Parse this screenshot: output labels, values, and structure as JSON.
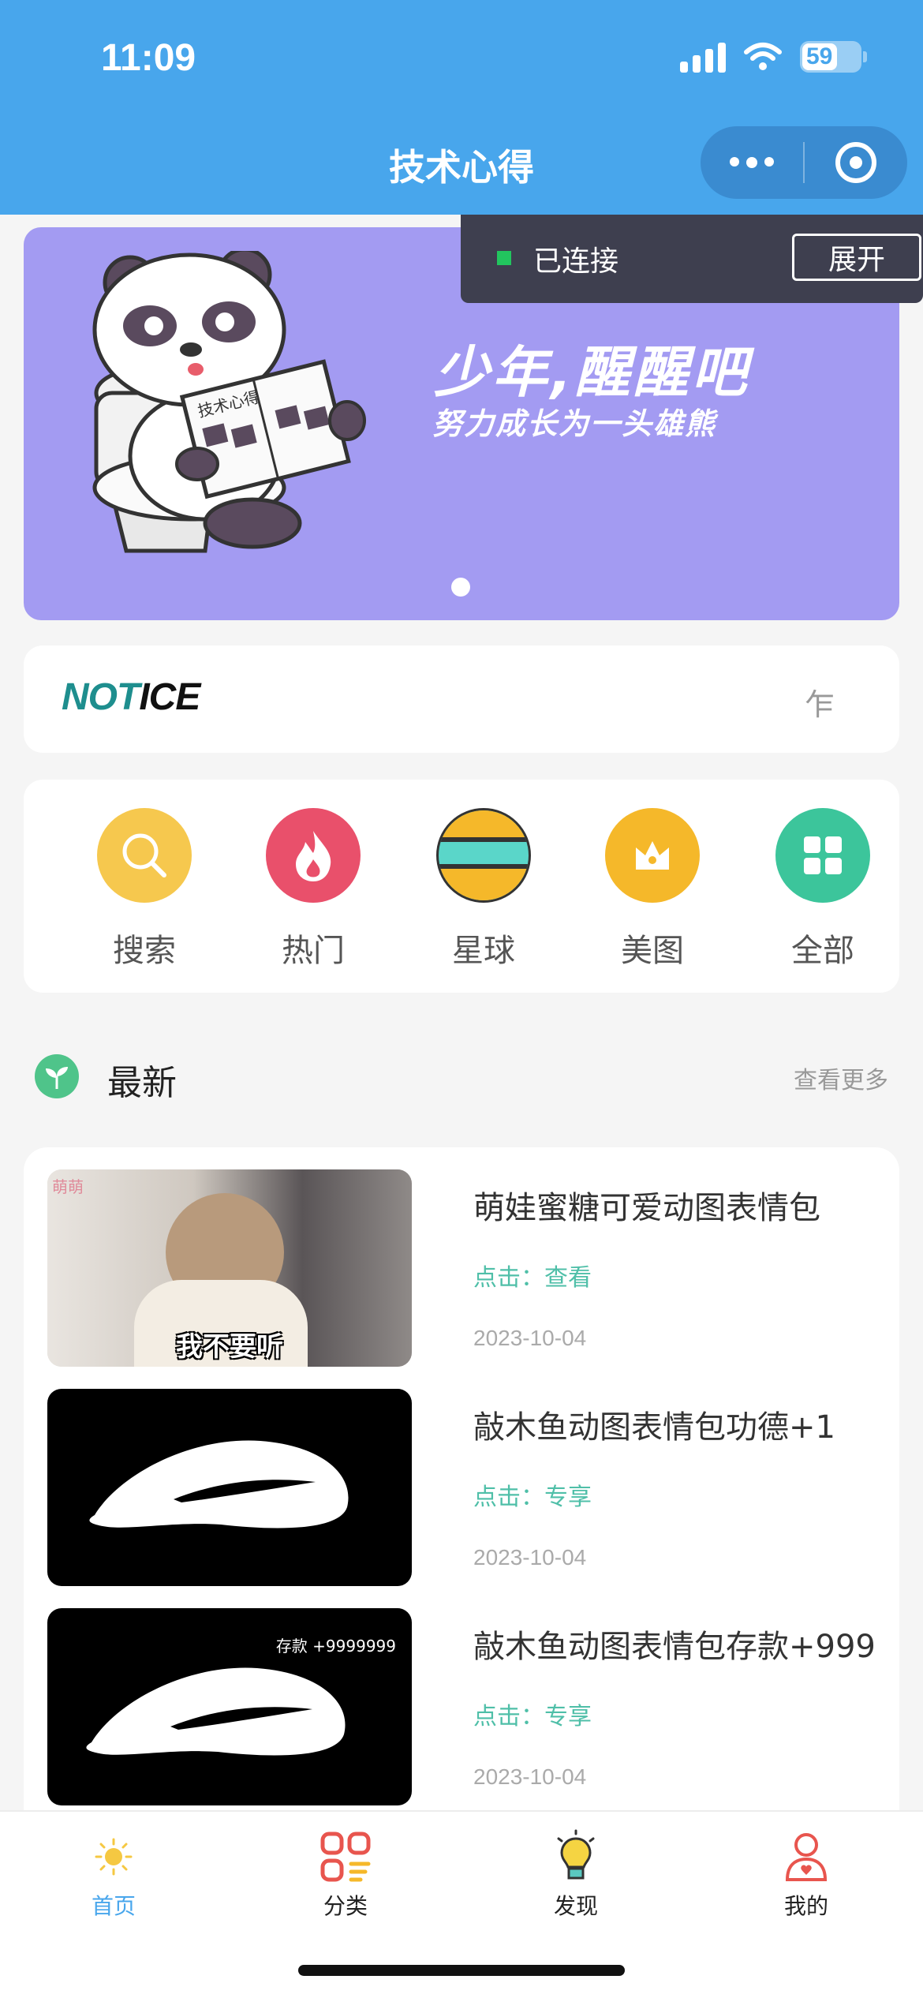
{
  "status_bar": {
    "time": "11:09",
    "battery": "59"
  },
  "nav": {
    "title": "技术心得"
  },
  "connection": {
    "status": "已连接",
    "expand_label": "展开"
  },
  "banner": {
    "line1": "少年,醒醒吧",
    "line2": "努力成长为一头雄熊",
    "book_text": "技术心得"
  },
  "notice": {
    "logo_a": "NOT",
    "logo_b": "ICE",
    "scroll_text": "乍"
  },
  "categories": [
    {
      "label": "搜索",
      "icon": "search-icon",
      "color": "#f6c84e"
    },
    {
      "label": "热门",
      "icon": "fire-icon",
      "color": "#e9506b"
    },
    {
      "label": "星球",
      "icon": "planet-icon",
      "color": "#5ad6c9"
    },
    {
      "label": "美图",
      "icon": "crown-icon",
      "color": "#f5b82a"
    },
    {
      "label": "全部",
      "icon": "grid-icon",
      "color": "#3cc59b"
    }
  ],
  "latest": {
    "title": "最新",
    "more": "查看更多"
  },
  "articles": [
    {
      "title": "萌娃蜜糖可爱动图表情包",
      "tag_prefix": "点击：",
      "tag": "查看",
      "date": "2023-10-04",
      "caption": "我不要听",
      "watermark": "萌萌"
    },
    {
      "title": "敲木鱼动图表情包功德+1",
      "tag_prefix": "点击：",
      "tag": "专享",
      "date": "2023-10-04",
      "caption": ""
    },
    {
      "title": "敲木鱼动图表情包存款+999",
      "tag_prefix": "点击：",
      "tag": "专享",
      "date": "2023-10-04",
      "caption": "存款 +9999999"
    }
  ],
  "tabs": [
    {
      "label": "首页",
      "icon": "sun-icon",
      "active": true
    },
    {
      "label": "分类",
      "icon": "category-icon",
      "active": false
    },
    {
      "label": "发现",
      "icon": "bulb-icon",
      "active": false
    },
    {
      "label": "我的",
      "icon": "user-icon",
      "active": false
    }
  ],
  "colors": {
    "primary": "#48a6ec",
    "banner": "#a39bf2",
    "accent": "#4fbfa8"
  }
}
